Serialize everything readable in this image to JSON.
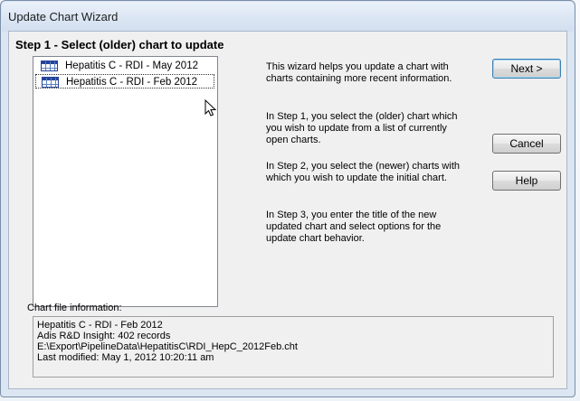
{
  "window": {
    "title": "Update Chart Wizard"
  },
  "step": {
    "title": "Step 1 - Select (older) chart to update"
  },
  "charts": [
    {
      "icon": "table-grid-icon",
      "label": "Hepatitis C - RDI - May 2012",
      "selected": false
    },
    {
      "icon": "table-grid-icon",
      "label": "Hepatitis C - RDI - Feb 2012",
      "selected": true
    }
  ],
  "info": {
    "p1": "This wizard helps you update a chart with charts containing more recent information.",
    "p2": "In Step 1, you select the (older) chart which you wish to update from a list of currently open charts.",
    "p3": "In Step 2, you select the (newer) charts with which you wish to update the initial chart.",
    "p4": "In Step 3, you enter the title of the new updated chart and select options for the update chart behavior."
  },
  "buttons": {
    "next": "Next >",
    "cancel": "Cancel",
    "help": "Help"
  },
  "file_info": {
    "label": "Chart file information:",
    "lines": [
      "Hepatitis C - RDI - Feb 2012",
      "Adis R&D Insight: 402 records",
      "E:\\Export\\PipelineData\\HepatitisC\\RDI_HepC_2012Feb.cht",
      "Last modified: May 1, 2012 10:20:11 am"
    ]
  }
}
